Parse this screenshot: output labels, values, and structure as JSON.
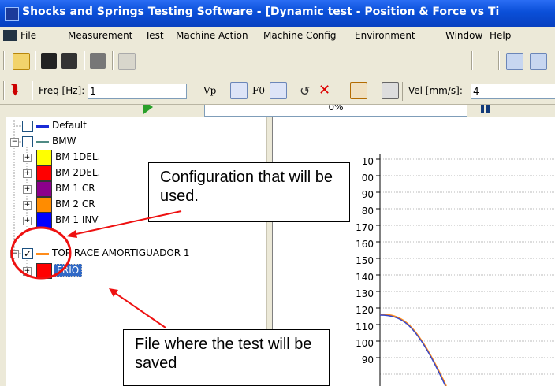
{
  "window": {
    "title": "Shocks and Springs Testing Software - [Dynamic test - Position & Force vs Ti"
  },
  "menu": [
    "File",
    "Measurement",
    "Test",
    "Machine Action",
    "Machine Config",
    "Environment",
    "Window",
    "Help"
  ],
  "toolbar": {
    "progress_text": "0%",
    "freq_label": "Freq [Hz]:",
    "freq_value": "1",
    "vp_label": "Vp",
    "f0_label": "F0",
    "vel_label": "Vel [mm/s]:",
    "vel_value": "4"
  },
  "tree": {
    "items": [
      {
        "label": "Default",
        "color": "#1a2bd6",
        "kind": "line",
        "checked": false
      },
      {
        "label": "BMW",
        "color": "#4f8a84",
        "kind": "line",
        "checked": false
      },
      {
        "label": "BM 1DEL.",
        "color": "#ffff00",
        "kind": "box"
      },
      {
        "label": "BM 2DEL.",
        "color": "#ff0000",
        "kind": "box"
      },
      {
        "label": "BM 1 CR",
        "color": "#8b008b",
        "kind": "box"
      },
      {
        "label": "BM 2 CR",
        "color": "#ff8c00",
        "kind": "box"
      },
      {
        "label": "BM 1 INV",
        "color": "#0000ff",
        "kind": "box"
      },
      {
        "label": "TOP RACE AMORTIGUADOR 1",
        "color": "#ff8c1a",
        "kind": "line",
        "checked": true
      },
      {
        "label": "FRIO",
        "color": "#ff0000",
        "kind": "box",
        "selected": true
      }
    ]
  },
  "chart": {
    "y_ticks": [
      "10",
      "00",
      "90",
      "80",
      "170",
      "160",
      "150",
      "140",
      "130",
      "120",
      "110",
      "100",
      "90"
    ]
  },
  "callouts": {
    "config": "Configuration that will be used.",
    "file": "File where the test will be saved"
  }
}
